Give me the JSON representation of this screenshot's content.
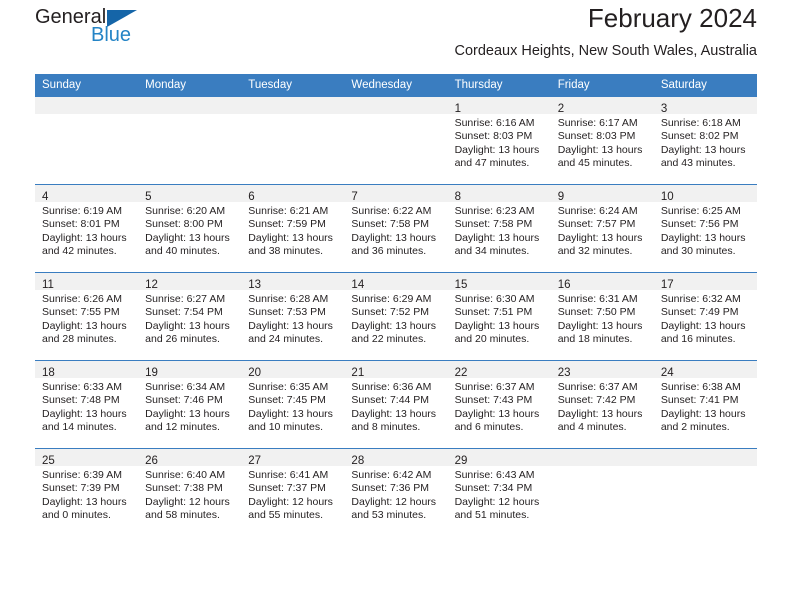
{
  "brand": {
    "word_top": "General",
    "word_bottom": "Blue",
    "triangle_icon": "triangle-icon",
    "color_blue": "#2484c6",
    "color_triangle": "#1565a8"
  },
  "header": {
    "title": "February 2024",
    "subtitle": "Cordeaux Heights, New South Wales, Australia"
  },
  "theme": {
    "header_row_bg": "#3a7dc0",
    "day_band_bg": "#f1f1f1",
    "text": "#231f20"
  },
  "calendar": {
    "weekday_headers": [
      "Sunday",
      "Monday",
      "Tuesday",
      "Wednesday",
      "Thursday",
      "Friday",
      "Saturday"
    ],
    "weeks": [
      [
        {
          "day": "",
          "sunrise": "",
          "sunset": "",
          "daylight_1": "",
          "daylight_2": ""
        },
        {
          "day": "",
          "sunrise": "",
          "sunset": "",
          "daylight_1": "",
          "daylight_2": ""
        },
        {
          "day": "",
          "sunrise": "",
          "sunset": "",
          "daylight_1": "",
          "daylight_2": ""
        },
        {
          "day": "",
          "sunrise": "",
          "sunset": "",
          "daylight_1": "",
          "daylight_2": ""
        },
        {
          "day": "1",
          "sunrise": "Sunrise: 6:16 AM",
          "sunset": "Sunset: 8:03 PM",
          "daylight_1": "Daylight: 13 hours",
          "daylight_2": "and 47 minutes."
        },
        {
          "day": "2",
          "sunrise": "Sunrise: 6:17 AM",
          "sunset": "Sunset: 8:03 PM",
          "daylight_1": "Daylight: 13 hours",
          "daylight_2": "and 45 minutes."
        },
        {
          "day": "3",
          "sunrise": "Sunrise: 6:18 AM",
          "sunset": "Sunset: 8:02 PM",
          "daylight_1": "Daylight: 13 hours",
          "daylight_2": "and 43 minutes."
        }
      ],
      [
        {
          "day": "4",
          "sunrise": "Sunrise: 6:19 AM",
          "sunset": "Sunset: 8:01 PM",
          "daylight_1": "Daylight: 13 hours",
          "daylight_2": "and 42 minutes."
        },
        {
          "day": "5",
          "sunrise": "Sunrise: 6:20 AM",
          "sunset": "Sunset: 8:00 PM",
          "daylight_1": "Daylight: 13 hours",
          "daylight_2": "and 40 minutes."
        },
        {
          "day": "6",
          "sunrise": "Sunrise: 6:21 AM",
          "sunset": "Sunset: 7:59 PM",
          "daylight_1": "Daylight: 13 hours",
          "daylight_2": "and 38 minutes."
        },
        {
          "day": "7",
          "sunrise": "Sunrise: 6:22 AM",
          "sunset": "Sunset: 7:58 PM",
          "daylight_1": "Daylight: 13 hours",
          "daylight_2": "and 36 minutes."
        },
        {
          "day": "8",
          "sunrise": "Sunrise: 6:23 AM",
          "sunset": "Sunset: 7:58 PM",
          "daylight_1": "Daylight: 13 hours",
          "daylight_2": "and 34 minutes."
        },
        {
          "day": "9",
          "sunrise": "Sunrise: 6:24 AM",
          "sunset": "Sunset: 7:57 PM",
          "daylight_1": "Daylight: 13 hours",
          "daylight_2": "and 32 minutes."
        },
        {
          "day": "10",
          "sunrise": "Sunrise: 6:25 AM",
          "sunset": "Sunset: 7:56 PM",
          "daylight_1": "Daylight: 13 hours",
          "daylight_2": "and 30 minutes."
        }
      ],
      [
        {
          "day": "11",
          "sunrise": "Sunrise: 6:26 AM",
          "sunset": "Sunset: 7:55 PM",
          "daylight_1": "Daylight: 13 hours",
          "daylight_2": "and 28 minutes."
        },
        {
          "day": "12",
          "sunrise": "Sunrise: 6:27 AM",
          "sunset": "Sunset: 7:54 PM",
          "daylight_1": "Daylight: 13 hours",
          "daylight_2": "and 26 minutes."
        },
        {
          "day": "13",
          "sunrise": "Sunrise: 6:28 AM",
          "sunset": "Sunset: 7:53 PM",
          "daylight_1": "Daylight: 13 hours",
          "daylight_2": "and 24 minutes."
        },
        {
          "day": "14",
          "sunrise": "Sunrise: 6:29 AM",
          "sunset": "Sunset: 7:52 PM",
          "daylight_1": "Daylight: 13 hours",
          "daylight_2": "and 22 minutes."
        },
        {
          "day": "15",
          "sunrise": "Sunrise: 6:30 AM",
          "sunset": "Sunset: 7:51 PM",
          "daylight_1": "Daylight: 13 hours",
          "daylight_2": "and 20 minutes."
        },
        {
          "day": "16",
          "sunrise": "Sunrise: 6:31 AM",
          "sunset": "Sunset: 7:50 PM",
          "daylight_1": "Daylight: 13 hours",
          "daylight_2": "and 18 minutes."
        },
        {
          "day": "17",
          "sunrise": "Sunrise: 6:32 AM",
          "sunset": "Sunset: 7:49 PM",
          "daylight_1": "Daylight: 13 hours",
          "daylight_2": "and 16 minutes."
        }
      ],
      [
        {
          "day": "18",
          "sunrise": "Sunrise: 6:33 AM",
          "sunset": "Sunset: 7:48 PM",
          "daylight_1": "Daylight: 13 hours",
          "daylight_2": "and 14 minutes."
        },
        {
          "day": "19",
          "sunrise": "Sunrise: 6:34 AM",
          "sunset": "Sunset: 7:46 PM",
          "daylight_1": "Daylight: 13 hours",
          "daylight_2": "and 12 minutes."
        },
        {
          "day": "20",
          "sunrise": "Sunrise: 6:35 AM",
          "sunset": "Sunset: 7:45 PM",
          "daylight_1": "Daylight: 13 hours",
          "daylight_2": "and 10 minutes."
        },
        {
          "day": "21",
          "sunrise": "Sunrise: 6:36 AM",
          "sunset": "Sunset: 7:44 PM",
          "daylight_1": "Daylight: 13 hours",
          "daylight_2": "and 8 minutes."
        },
        {
          "day": "22",
          "sunrise": "Sunrise: 6:37 AM",
          "sunset": "Sunset: 7:43 PM",
          "daylight_1": "Daylight: 13 hours",
          "daylight_2": "and 6 minutes."
        },
        {
          "day": "23",
          "sunrise": "Sunrise: 6:37 AM",
          "sunset": "Sunset: 7:42 PM",
          "daylight_1": "Daylight: 13 hours",
          "daylight_2": "and 4 minutes."
        },
        {
          "day": "24",
          "sunrise": "Sunrise: 6:38 AM",
          "sunset": "Sunset: 7:41 PM",
          "daylight_1": "Daylight: 13 hours",
          "daylight_2": "and 2 minutes."
        }
      ],
      [
        {
          "day": "25",
          "sunrise": "Sunrise: 6:39 AM",
          "sunset": "Sunset: 7:39 PM",
          "daylight_1": "Daylight: 13 hours",
          "daylight_2": "and 0 minutes."
        },
        {
          "day": "26",
          "sunrise": "Sunrise: 6:40 AM",
          "sunset": "Sunset: 7:38 PM",
          "daylight_1": "Daylight: 12 hours",
          "daylight_2": "and 58 minutes."
        },
        {
          "day": "27",
          "sunrise": "Sunrise: 6:41 AM",
          "sunset": "Sunset: 7:37 PM",
          "daylight_1": "Daylight: 12 hours",
          "daylight_2": "and 55 minutes."
        },
        {
          "day": "28",
          "sunrise": "Sunrise: 6:42 AM",
          "sunset": "Sunset: 7:36 PM",
          "daylight_1": "Daylight: 12 hours",
          "daylight_2": "and 53 minutes."
        },
        {
          "day": "29",
          "sunrise": "Sunrise: 6:43 AM",
          "sunset": "Sunset: 7:34 PM",
          "daylight_1": "Daylight: 12 hours",
          "daylight_2": "and 51 minutes."
        },
        {
          "day": "",
          "sunrise": "",
          "sunset": "",
          "daylight_1": "",
          "daylight_2": ""
        },
        {
          "day": "",
          "sunrise": "",
          "sunset": "",
          "daylight_1": "",
          "daylight_2": ""
        }
      ]
    ]
  }
}
